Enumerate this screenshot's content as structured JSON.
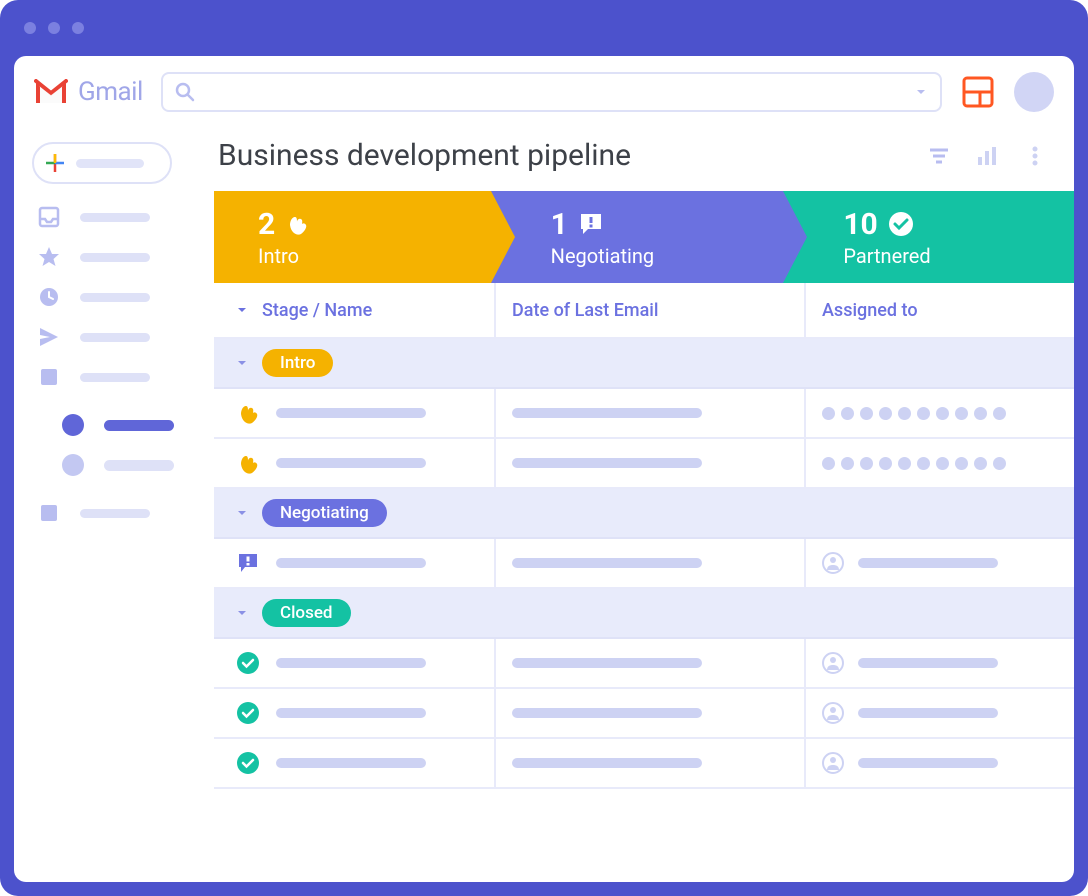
{
  "app": {
    "name": "Gmail"
  },
  "page": {
    "title": "Business development pipeline"
  },
  "stages": [
    {
      "count": "2",
      "label": "Intro",
      "icon": "wave"
    },
    {
      "count": "1",
      "label": "Negotiating",
      "icon": "chat-alert"
    },
    {
      "count": "10",
      "label": "Partnered",
      "icon": "check-circle"
    }
  ],
  "columns": {
    "stage_name": "Stage / Name",
    "date": "Date of Last Email",
    "assigned": "Assigned to"
  },
  "groups": {
    "intro": "Intro",
    "negotiating": "Negotiating",
    "closed": "Closed"
  }
}
